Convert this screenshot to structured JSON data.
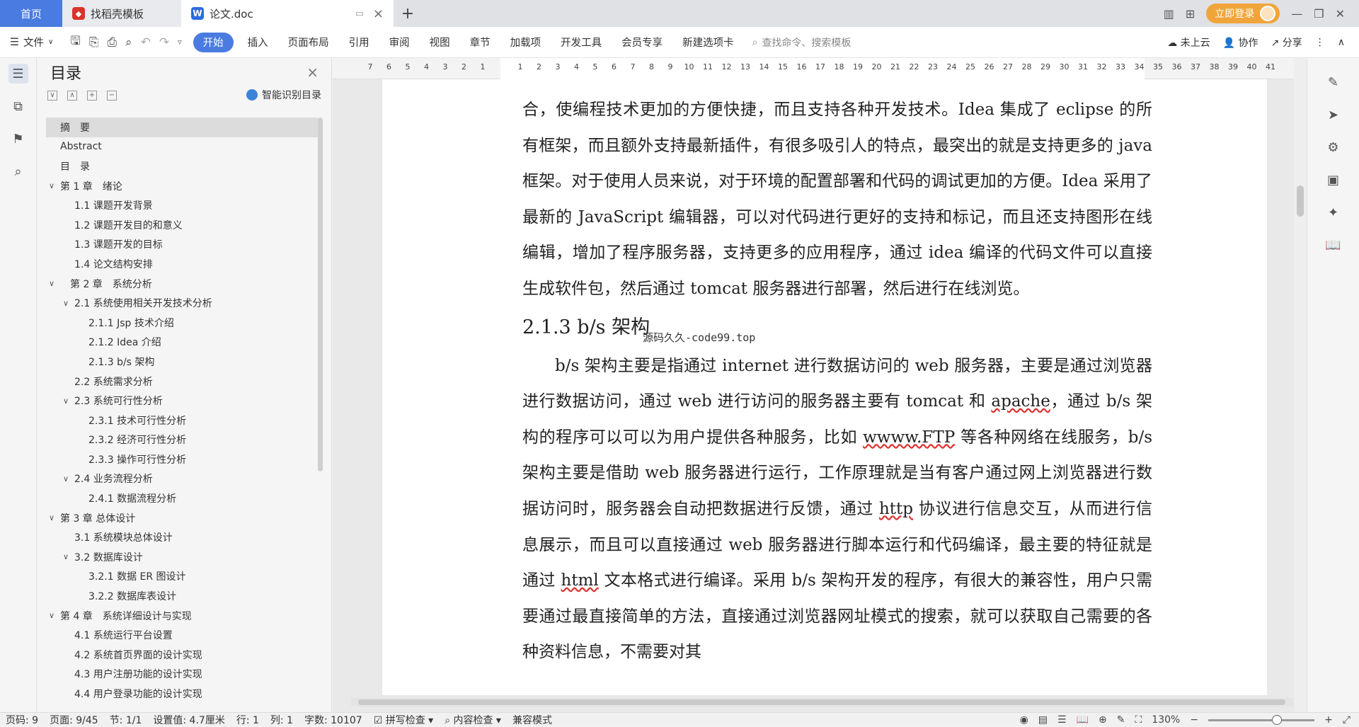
{
  "tabs": {
    "home": "首页",
    "template": "找稻壳模板",
    "doc": "论文.doc"
  },
  "window": {
    "login": "立即登录"
  },
  "menu": {
    "file": "文件",
    "items": [
      "开始",
      "插入",
      "页面布局",
      "引用",
      "审阅",
      "视图",
      "章节",
      "加载项",
      "开发工具",
      "会员专享",
      "新建选项卡"
    ],
    "search_placeholder": "查找命令、搜索模板",
    "cloud": "未上云",
    "collab": "协作",
    "share": "分享"
  },
  "toc": {
    "title": "目录",
    "smart": "智能识别目录",
    "items": [
      {
        "text": "摘　要",
        "level": 1,
        "chevron": "",
        "selected": true
      },
      {
        "text": "Abstract",
        "level": 1,
        "chevron": ""
      },
      {
        "text": "目　录",
        "level": 1,
        "chevron": ""
      },
      {
        "text": "第 1 章　绪论",
        "level": 1,
        "chevron": "v"
      },
      {
        "text": "1.1 课题开发背景",
        "level": 2,
        "chevron": ""
      },
      {
        "text": "1.2 课题开发目的和意义",
        "level": 2,
        "chevron": ""
      },
      {
        "text": "1.3 课题开发的目标",
        "level": 2,
        "chevron": ""
      },
      {
        "text": "1.4 论文结构安排",
        "level": 2,
        "chevron": ""
      },
      {
        "text": "第 2 章　系统分析",
        "level": 1,
        "chevron": "v",
        "extra": true
      },
      {
        "text": "2.1 系统使用相关开发技术分析",
        "level": 2,
        "chevron": "v"
      },
      {
        "text": "2.1.1 Jsp 技术介绍",
        "level": 3,
        "chevron": ""
      },
      {
        "text": "2.1.2 Idea 介绍",
        "level": 3,
        "chevron": ""
      },
      {
        "text": "2.1.3 b/s 架构",
        "level": 3,
        "chevron": ""
      },
      {
        "text": "2.2 系统需求分析",
        "level": 2,
        "chevron": ""
      },
      {
        "text": "2.3 系统可行性分析",
        "level": 2,
        "chevron": "v"
      },
      {
        "text": "2.3.1 技术可行性分析",
        "level": 3,
        "chevron": ""
      },
      {
        "text": "2.3.2 经济可行性分析",
        "level": 3,
        "chevron": ""
      },
      {
        "text": "2.3.3  操作可行性分析",
        "level": 3,
        "chevron": ""
      },
      {
        "text": "2.4 业务流程分析",
        "level": 2,
        "chevron": "v"
      },
      {
        "text": "2.4.1 数据流程分析",
        "level": 3,
        "chevron": ""
      },
      {
        "text": "第 3 章  总体设计",
        "level": 1,
        "chevron": "v"
      },
      {
        "text": "3.1 系统模块总体设计",
        "level": 2,
        "chevron": ""
      },
      {
        "text": "3.2 数据库设计",
        "level": 2,
        "chevron": "v"
      },
      {
        "text": "3.2.1 数据 ER 图设计",
        "level": 3,
        "chevron": ""
      },
      {
        "text": "3.2.2 数据库表设计",
        "level": 3,
        "chevron": ""
      },
      {
        "text": "第 4 章　系统详细设计与实现",
        "level": 1,
        "chevron": "v"
      },
      {
        "text": "4.1 系统运行平台设置",
        "level": 2,
        "chevron": ""
      },
      {
        "text": "4.2 系统首页界面的设计实现",
        "level": 2,
        "chevron": ""
      },
      {
        "text": "4.3 用户注册功能的设计实现",
        "level": 2,
        "chevron": ""
      },
      {
        "text": "4.4 用户登录功能的设计实现",
        "level": 2,
        "chevron": ""
      }
    ]
  },
  "ruler": [
    "7",
    "6",
    "5",
    "4",
    "3",
    "2",
    "1",
    "",
    "1",
    "2",
    "3",
    "4",
    "5",
    "6",
    "7",
    "8",
    "9",
    "10",
    "11",
    "12",
    "13",
    "14",
    "15",
    "16",
    "17",
    "18",
    "19",
    "20",
    "21",
    "22",
    "23",
    "24",
    "25",
    "26",
    "27",
    "28",
    "29",
    "30",
    "31",
    "32",
    "33",
    "34",
    "35",
    "36",
    "37",
    "38",
    "39",
    "40",
    "41"
  ],
  "document": {
    "para1": "合，使编程技术更加的方便快捷，而且支持各种开发技术。Idea 集成了 eclipse 的所有框架，而且额外支持最新插件，有很多吸引人的特点，最突出的就是支持更多的 java 框架。对于使用人员来说，对于环境的配置部署和代码的调试更加的方便。Idea 采用了最新的 JavaScript 编辑器，可以对代码进行更好的支持和标记，而且还支持图形在线编辑，增加了程序服务器，支持更多的应用程序，通过 idea 编译的代码文件可以直接生成软件包，然后通过 tomcat 服务器进行部署，然后进行在线浏览。",
    "heading": "2.1.3 b/s 架构",
    "watermark": "源码久久-code99.top",
    "para2a": "b/s 架构主要是指通过 internet 进行数据访问的 web 服务器，主要是通过浏览器进行数据访问，通过 web 进行访问的服务器主要有 tomcat 和 ",
    "apache": "apache",
    "para2b": "，通过 b/s 架构的程序可以可以为用户提供各种服务，比如 ",
    "wwww": "wwww.FTP",
    "para2c": " 等各种网络在线服务，b/s 架构主要是借助 web 服务器进行运行，工作原理就是当有客户通过网上浏览器进行数据访问时，服务器会自动把数据进行反馈，通过 ",
    "http": "http",
    "para2d": " 协议进行信息交互，从而进行信息展示，而且可以直接通过 web 服务器进行脚本运行和代码编译，最主要的特征就是通过 ",
    "html": "html",
    "para2e": " 文本格式进行编译。采用 b/s 架构开发的程序，有很大的兼容性，用户只需要通过最直接简单的方法，直接通过浏览器网址模式的搜索，就可以获取自己需要的各种资料信息，不需要对其"
  },
  "status": {
    "page_code": "页码: 9",
    "page": "页面: 9/45",
    "section": "节: 1/1",
    "setting": "设置值: 4.7厘米",
    "row": "行: 1",
    "col": "列: 1",
    "words": "字数: 10107",
    "spell": "拼写检查",
    "content": "内容检查",
    "compat": "兼容模式",
    "zoom": "130%"
  },
  "colors": {
    "accent": "#4a7be0",
    "login": "#f0a53a"
  }
}
